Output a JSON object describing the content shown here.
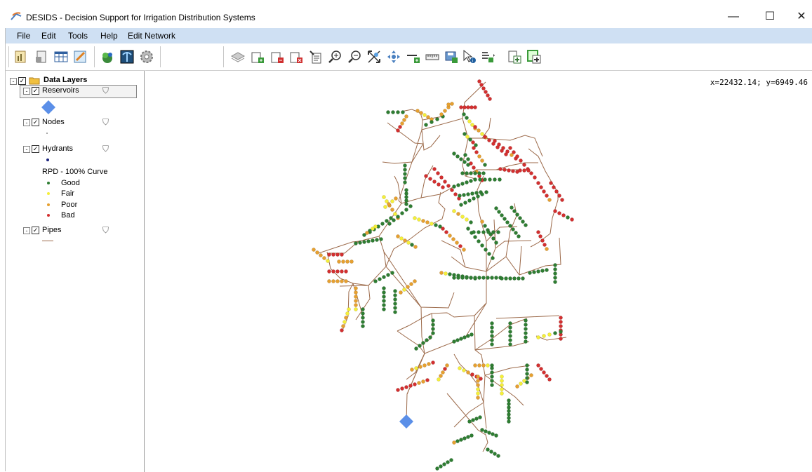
{
  "window": {
    "title": "DESIDS - Decision Support for Irrigation Distribution Systems",
    "minimize_glyph": "—",
    "maximize_glyph": "☐",
    "close_glyph": "✕"
  },
  "menu": [
    "File",
    "Edit",
    "Tools",
    "Help",
    "Edit Network"
  ],
  "toolbar_icons": [
    "chart-icon",
    "report-icon",
    "table-icon",
    "edit-map-icon",
    "plant-icon",
    "irrigation-icon",
    "settings-icon",
    "layers-icon",
    "add-layer-icon",
    "remove-layer-icon",
    "delete-layer-icon",
    "properties-icon",
    "zoom-in-icon",
    "zoom-out-icon",
    "zoom-extent-icon",
    "pan-icon",
    "add-pipe-icon",
    "measure-icon",
    "save-icon",
    "identify-icon",
    "list-icon",
    "export-icon",
    "export-all-icon"
  ],
  "map": {
    "coords": "x=22432.14; y=6949.46"
  },
  "layers": {
    "root": "Data Layers",
    "reservoirs": "Reservoirs",
    "nodes": "Nodes",
    "hydrants": "Hydrants",
    "curve_title": "RPD - 100% Curve",
    "legend": [
      {
        "label": "Good",
        "color": "#2e7d32"
      },
      {
        "label": "Fair",
        "color": "#f5ef3a"
      },
      {
        "label": "Poor",
        "color": "#e6a030"
      },
      {
        "label": "Bad",
        "color": "#d32f2f"
      }
    ],
    "pipes": "Pipes"
  },
  "colors": {
    "reservoir": "#5b8fe8",
    "pipe": "#9c6a4a",
    "menubar": "#cfe0f3"
  }
}
